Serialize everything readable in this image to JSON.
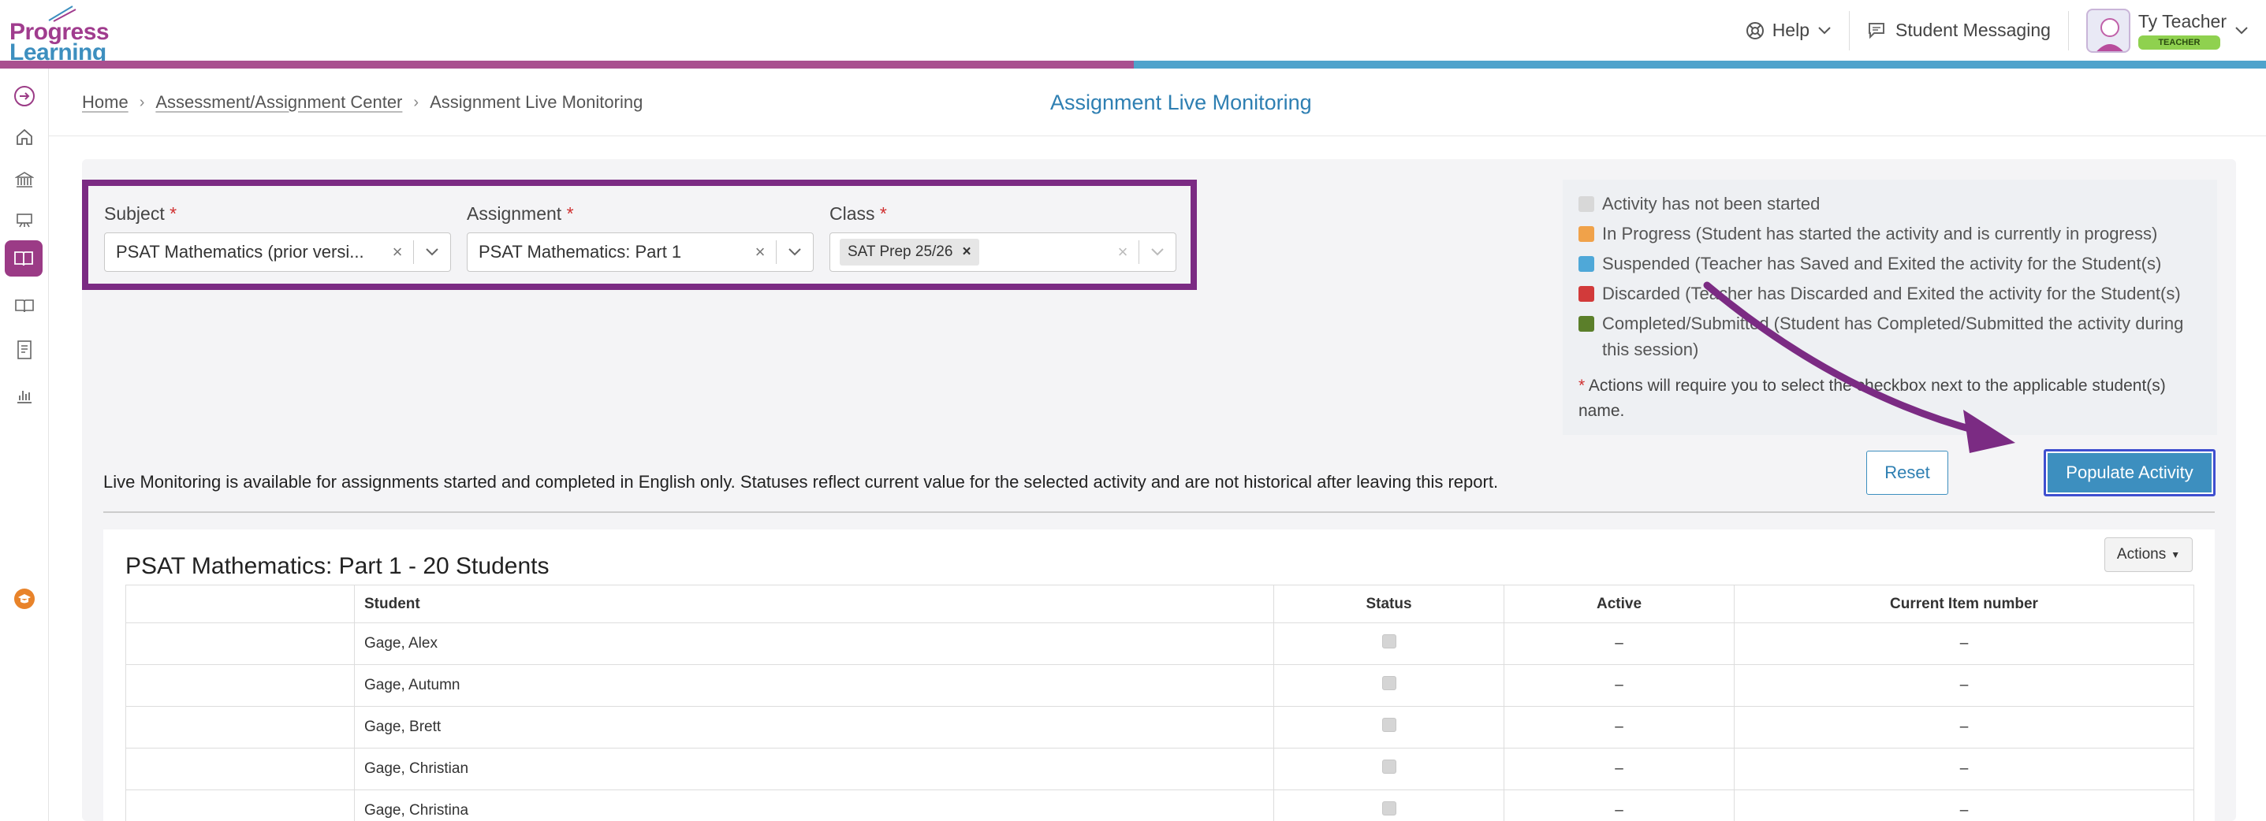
{
  "header": {
    "logo_line1": "Progress",
    "logo_line2": "Learning",
    "help_label": "Help",
    "messaging_label": "Student Messaging",
    "user_name": "Ty Teacher",
    "user_role": "TEACHER"
  },
  "breadcrumb": {
    "home": "Home",
    "center": "Assessment/Assignment Center",
    "current": "Assignment Live Monitoring"
  },
  "page_title": "Assignment Live Monitoring",
  "filters": {
    "subject_label": "Subject",
    "subject_value": "PSAT Mathematics (prior versi...",
    "assignment_label": "Assignment",
    "assignment_value": "PSAT Mathematics: Part 1",
    "class_label": "Class",
    "class_chip": "SAT Prep 25/26",
    "required_mark": "*",
    "clear_glyph": "×"
  },
  "legend": {
    "items": [
      {
        "text": "Activity has not been started",
        "color": "#d8d8d8"
      },
      {
        "text": "In Progress (Student has started the activity and is currently in progress)",
        "color": "#f0a24a"
      },
      {
        "text": "Suspended (Teacher has Saved and Exited the activity for the Student(s)",
        "color": "#4fa8d8"
      },
      {
        "text": "Discarded (Teacher has Discarded and Exited the activity for the Student(s)",
        "color": "#d23a3a"
      },
      {
        "text": "Completed/Submitted (Student has Completed/Submitted the activity during this session)",
        "color": "#5b7f2a"
      }
    ],
    "note": "Actions will require you to select the checkbox next to the applicable student(s) name."
  },
  "buttons": {
    "reset": "Reset",
    "populate": "Populate Activity",
    "actions": "Actions"
  },
  "notice": "Live Monitoring is available for assignments started and completed in English only. Statuses reflect current value for the selected activity and are not historical after leaving this report.",
  "table": {
    "title": "PSAT Mathematics: Part 1 - 20 Students",
    "columns": [
      "",
      "Student",
      "Status",
      "Active",
      "Current Item number"
    ],
    "rows": [
      {
        "student": "Gage, Alex",
        "active": "–",
        "item": "–"
      },
      {
        "student": "Gage, Autumn",
        "active": "–",
        "item": "–"
      },
      {
        "student": "Gage, Brett",
        "active": "–",
        "item": "–"
      },
      {
        "student": "Gage, Christian",
        "active": "–",
        "item": "–"
      },
      {
        "student": "Gage, Christina",
        "active": "–",
        "item": "–"
      }
    ]
  },
  "colors": {
    "brand_purple": "#a03c8e",
    "brand_blue": "#3d8fbf",
    "highlight_border": "#7b2b83",
    "arrow": "#7b2b83"
  }
}
